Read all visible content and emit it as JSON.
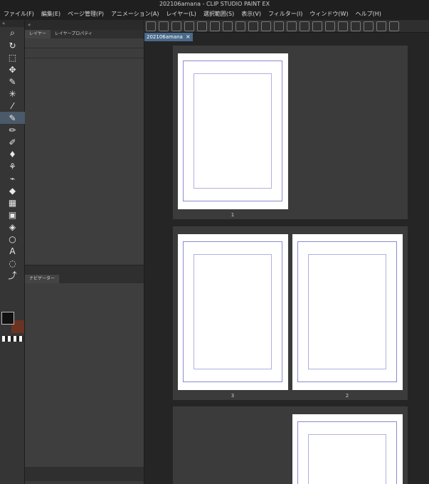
{
  "app": {
    "title": "202106amana - CLIP STUDIO PAINT EX"
  },
  "menu": [
    "ファイル(F)",
    "編集(E)",
    "ページ管理(P)",
    "アニメーション(A)",
    "レイヤー(L)",
    "選択範囲(S)",
    "表示(V)",
    "フィルター(I)",
    "ウィンドウ(W)",
    "ヘルプ(H)"
  ],
  "panels": {
    "layer_tab": "レイヤー",
    "layer_property_tab": "レイヤープロパティ",
    "navigator_tab": "ナビゲーター"
  },
  "document": {
    "tab": "202106amana",
    "pages": [
      "1",
      "3",
      "2"
    ]
  },
  "colors": {
    "main": "#111111",
    "sub": "#6b3322",
    "accent": "#4a6a8a"
  }
}
